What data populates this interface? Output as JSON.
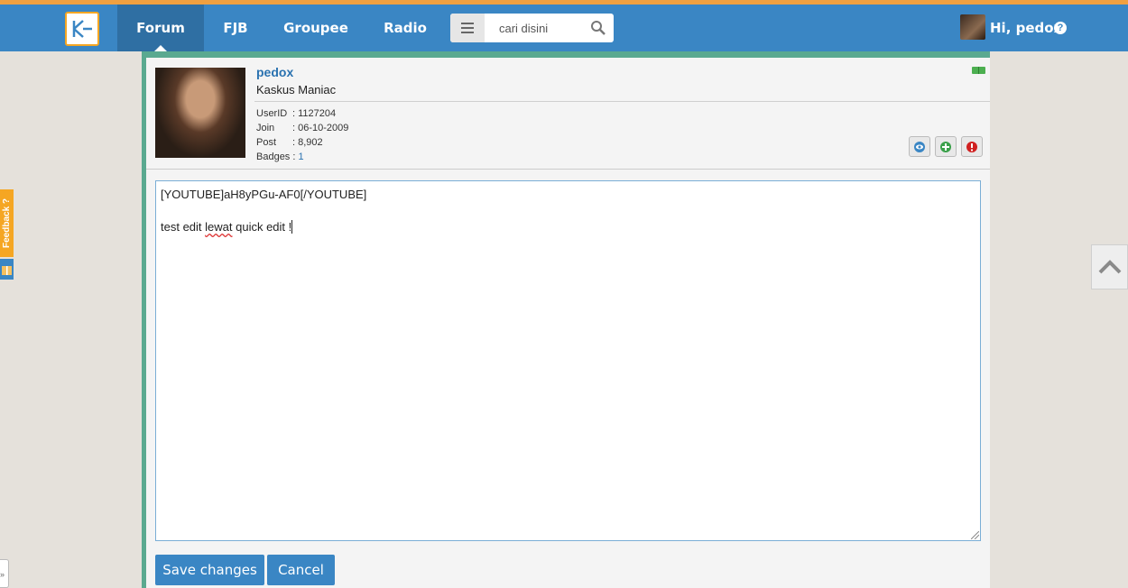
{
  "nav": {
    "logo_letter": "K",
    "items": [
      {
        "label": "Forum"
      },
      {
        "label": "FJB"
      },
      {
        "label": "Groupee"
      },
      {
        "label": "Radio"
      }
    ],
    "search_placeholder": "cari disini",
    "user_greeting": "Hi, pedox",
    "help_glyph": "?"
  },
  "post": {
    "username": "pedox",
    "rank": "Kaskus Maniac",
    "stats": [
      {
        "key": "UserID",
        "value": ": 1127204"
      },
      {
        "key": "Join",
        "value": ": 06-10-2009"
      },
      {
        "key": "Post",
        "value": ": 8,902"
      },
      {
        "key": "Badges",
        "value": " : ",
        "link": "1"
      }
    ]
  },
  "editor": {
    "line1": "[YOUTUBE]aH8yPGu-AF0[/YOUTUBE]",
    "line2_pre": "test edit ",
    "line2_misspelled": "lewat",
    "line2_post": " quick edit !"
  },
  "buttons": {
    "save": "Save changes",
    "cancel": "Cancel"
  },
  "side": {
    "feedback": "Feedback ?",
    "toggle_glyph": "»"
  },
  "colors": {
    "nav_bg": "#3a86c4",
    "accent": "#f0a040",
    "panel_border": "#5aa990",
    "link": "#2a72b0"
  }
}
